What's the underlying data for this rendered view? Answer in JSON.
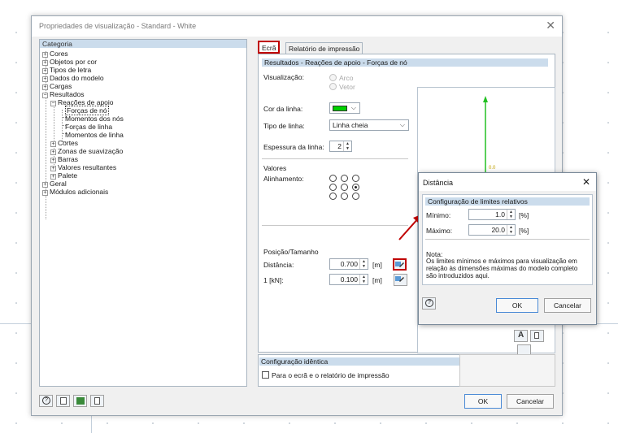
{
  "window": {
    "title": "Propriedades de visualização - Standard - White",
    "close_glyph": "✕"
  },
  "tree": {
    "header": "Categoria",
    "items": [
      {
        "label": "Cores",
        "expander": "+"
      },
      {
        "label": "Objetos por cor",
        "expander": "+"
      },
      {
        "label": "Tipos de letra",
        "expander": "+"
      },
      {
        "label": "Dados do modelo",
        "expander": "+"
      },
      {
        "label": "Cargas",
        "expander": "+"
      },
      {
        "label": "Resultados",
        "expander": "−"
      },
      {
        "label": "Reações de apoio",
        "expander": "−"
      },
      {
        "label": "Forças de nó",
        "expander": ""
      },
      {
        "label": "Momentos dos nós",
        "expander": ""
      },
      {
        "label": "Forças de linha",
        "expander": ""
      },
      {
        "label": "Momentos de linha",
        "expander": ""
      },
      {
        "label": "Cortes",
        "expander": "+"
      },
      {
        "label": "Zonas de suavização",
        "expander": "+"
      },
      {
        "label": "Barras",
        "expander": "+"
      },
      {
        "label": "Valores resultantes",
        "expander": "+"
      },
      {
        "label": "Palete",
        "expander": "+"
      },
      {
        "label": "Geral",
        "expander": "+"
      },
      {
        "label": "Módulos adicionais",
        "expander": "+"
      }
    ]
  },
  "tabs": [
    {
      "label": "Ecrã",
      "active": true
    },
    {
      "label": "Relatório de impressão",
      "active": false
    }
  ],
  "panel": {
    "section_title": "Resultados - Reações de apoio - Forças de nó",
    "visualizacao_label": "Visualização:",
    "visualizacao_options": [
      "Arco",
      "Vetor"
    ],
    "cor_linha_label": "Cor da linha:",
    "cor_linha_value": "#00d000",
    "tipo_linha_label": "Tipo de linha:",
    "tipo_linha_value": "Linha cheia",
    "espessura_label": "Espessura da linha:",
    "espessura_value": "2",
    "valores_label": "Valores",
    "alinhamento_label": "Alinhamento:",
    "alinhamento_selected": 5,
    "posicao_label": "Posição/Tamanho",
    "distancia_label": "Distância:",
    "distancia_value": "0.700",
    "distancia_unit": "[m]",
    "kn_label": "1 [kN]:",
    "kn_value": "0.100",
    "kn_unit": "[m]",
    "preview_value_label": "0.0",
    "preview_arrow_color": "#22c022"
  },
  "same_config": {
    "title": "Configuração idêntica",
    "checkbox_label": "Para o ecrã e o relatório de impressão",
    "checked": false
  },
  "buttons": {
    "ok": "OK",
    "cancel": "Cancelar"
  },
  "popup": {
    "title": "Distância",
    "close_glyph": "✕",
    "section_title": "Configuração de limites relativos",
    "min_label": "Mínimo:",
    "min_value": "1.0",
    "max_label": "Máximo:",
    "max_value": "20.0",
    "unit": "[%]",
    "note_title": "Nota:",
    "note_text": "Os limites mínimos e máximos para visualização em relação às dimensões máximas do modelo completo são introduzidos aqui.",
    "ok": "OK",
    "cancel": "Cancelar"
  },
  "colors": {
    "highlight_red": "#c00000",
    "section_header": "#cbdcec",
    "line_green": "#00d000"
  }
}
